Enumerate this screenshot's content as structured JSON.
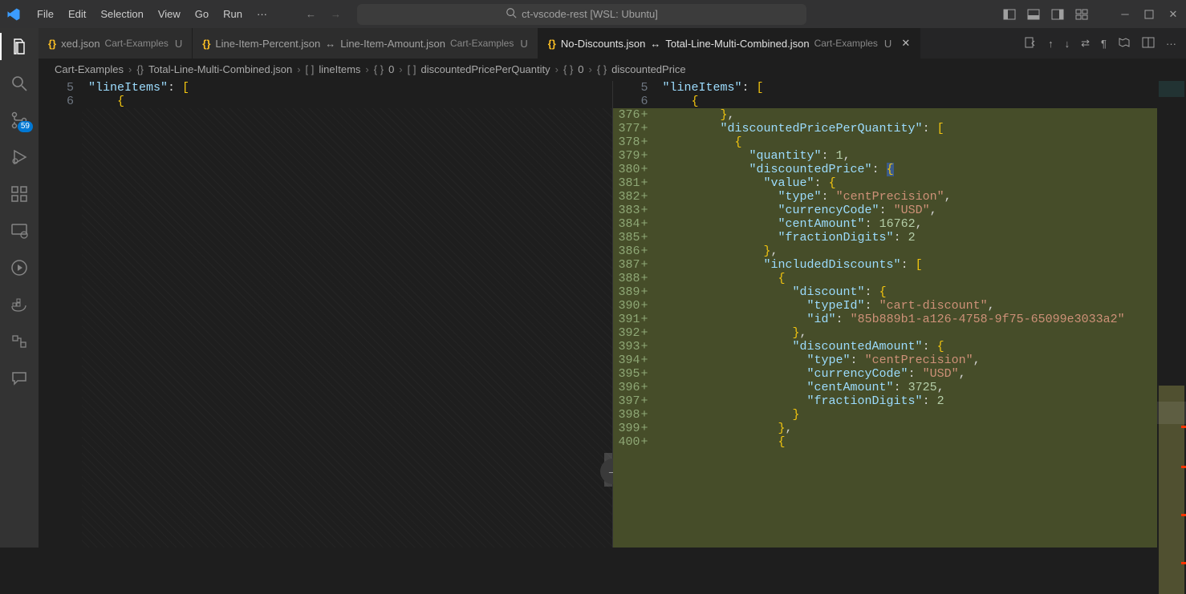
{
  "menu": [
    "File",
    "Edit",
    "Selection",
    "View",
    "Go",
    "Run",
    "···"
  ],
  "search_label": "ct-vscode-rest [WSL: Ubuntu]",
  "scm_badge": "59",
  "tabs": [
    {
      "icon": "{}",
      "title": "xed.json",
      "folder": "Cart-Examples",
      "mod": "U",
      "diff": false,
      "active": false
    },
    {
      "icon": "{}",
      "title": "Line-Item-Percent.json",
      "right": "Line-Item-Amount.json",
      "folder": "Cart-Examples",
      "mod": "U",
      "diff": true,
      "active": false
    },
    {
      "icon": "{}",
      "title": "No-Discounts.json",
      "right": "Total-Line-Multi-Combined.json",
      "folder": "Cart-Examples",
      "mod": "U",
      "diff": true,
      "active": true
    }
  ],
  "breadcrumb": [
    {
      "t": "Cart-Examples",
      "i": ""
    },
    {
      "t": "Total-Line-Multi-Combined.json",
      "i": "{}"
    },
    {
      "t": "lineItems",
      "i": "[ ]"
    },
    {
      "t": "0",
      "i": "{ }"
    },
    {
      "t": "discountedPricePerQuantity",
      "i": "[ ]"
    },
    {
      "t": "0",
      "i": "{ }"
    },
    {
      "t": "discountedPrice",
      "i": "{ }"
    }
  ],
  "left_header": [
    {
      "n": "5",
      "txt": [
        [
          "k",
          "\"lineItems\""
        ],
        [
          "p",
          ": "
        ],
        [
          "b",
          "["
        ]
      ]
    },
    {
      "n": "6",
      "txt": [
        [
          "b",
          "    {"
        ]
      ]
    }
  ],
  "right_header": [
    {
      "n": "5",
      "txt": [
        [
          "k",
          "\"lineItems\""
        ],
        [
          "p",
          ": "
        ],
        [
          "b",
          "["
        ]
      ]
    },
    {
      "n": "6",
      "txt": [
        [
          "b",
          "    {"
        ]
      ]
    }
  ],
  "right_lines": [
    {
      "n": "376",
      "txt": [
        [
          "p",
          "        "
        ],
        [
          "b",
          "}"
        ],
        [
          "p",
          ","
        ]
      ]
    },
    {
      "n": "377",
      "txt": [
        [
          "p",
          "        "
        ],
        [
          "k",
          "\"discountedPricePerQuantity\""
        ],
        [
          "p",
          ": "
        ],
        [
          "b",
          "["
        ]
      ]
    },
    {
      "n": "378",
      "txt": [
        [
          "p",
          "          "
        ],
        [
          "b",
          "{"
        ]
      ]
    },
    {
      "n": "379",
      "txt": [
        [
          "p",
          "            "
        ],
        [
          "k",
          "\"quantity\""
        ],
        [
          "p",
          ": "
        ],
        [
          "n",
          "1"
        ],
        [
          "p",
          ","
        ]
      ]
    },
    {
      "n": "380",
      "txt": [
        [
          "p",
          "            "
        ],
        [
          "k",
          "\"discountedPrice\""
        ],
        [
          "p",
          ": "
        ],
        [
          "hb",
          "{"
        ]
      ]
    },
    {
      "n": "381",
      "txt": [
        [
          "p",
          "              "
        ],
        [
          "k",
          "\"value\""
        ],
        [
          "p",
          ": "
        ],
        [
          "b",
          "{"
        ]
      ]
    },
    {
      "n": "382",
      "txt": [
        [
          "p",
          "                "
        ],
        [
          "k",
          "\"type\""
        ],
        [
          "p",
          ": "
        ],
        [
          "s",
          "\"centPrecision\""
        ],
        [
          "p",
          ","
        ]
      ]
    },
    {
      "n": "383",
      "txt": [
        [
          "p",
          "                "
        ],
        [
          "k",
          "\"currencyCode\""
        ],
        [
          "p",
          ": "
        ],
        [
          "s",
          "\"USD\""
        ],
        [
          "p",
          ","
        ]
      ]
    },
    {
      "n": "384",
      "txt": [
        [
          "p",
          "                "
        ],
        [
          "k",
          "\"centAmount\""
        ],
        [
          "p",
          ": "
        ],
        [
          "n",
          "16762"
        ],
        [
          "p",
          ","
        ]
      ]
    },
    {
      "n": "385",
      "txt": [
        [
          "p",
          "                "
        ],
        [
          "k",
          "\"fractionDigits\""
        ],
        [
          "p",
          ": "
        ],
        [
          "n",
          "2"
        ]
      ]
    },
    {
      "n": "386",
      "txt": [
        [
          "p",
          "              "
        ],
        [
          "b",
          "}"
        ],
        [
          "p",
          ","
        ]
      ]
    },
    {
      "n": "387",
      "txt": [
        [
          "p",
          "              "
        ],
        [
          "k",
          "\"includedDiscounts\""
        ],
        [
          "p",
          ": "
        ],
        [
          "b",
          "["
        ]
      ]
    },
    {
      "n": "388",
      "txt": [
        [
          "p",
          "                "
        ],
        [
          "b",
          "{"
        ]
      ]
    },
    {
      "n": "389",
      "txt": [
        [
          "p",
          "                  "
        ],
        [
          "k",
          "\"discount\""
        ],
        [
          "p",
          ": "
        ],
        [
          "b",
          "{"
        ]
      ]
    },
    {
      "n": "390",
      "txt": [
        [
          "p",
          "                    "
        ],
        [
          "k",
          "\"typeId\""
        ],
        [
          "p",
          ": "
        ],
        [
          "s",
          "\"cart-discount\""
        ],
        [
          "p",
          ","
        ]
      ]
    },
    {
      "n": "391",
      "txt": [
        [
          "p",
          "                    "
        ],
        [
          "k",
          "\"id\""
        ],
        [
          "p",
          ": "
        ],
        [
          "s",
          "\"85b889b1-a126-4758-9f75-65099e3033a2\""
        ]
      ]
    },
    {
      "n": "392",
      "txt": [
        [
          "p",
          "                  "
        ],
        [
          "b",
          "}"
        ],
        [
          "p",
          ","
        ]
      ]
    },
    {
      "n": "393",
      "txt": [
        [
          "p",
          "                  "
        ],
        [
          "k",
          "\"discountedAmount\""
        ],
        [
          "p",
          ": "
        ],
        [
          "b",
          "{"
        ]
      ]
    },
    {
      "n": "394",
      "txt": [
        [
          "p",
          "                    "
        ],
        [
          "k",
          "\"type\""
        ],
        [
          "p",
          ": "
        ],
        [
          "s",
          "\"centPrecision\""
        ],
        [
          "p",
          ","
        ]
      ]
    },
    {
      "n": "395",
      "txt": [
        [
          "p",
          "                    "
        ],
        [
          "k",
          "\"currencyCode\""
        ],
        [
          "p",
          ": "
        ],
        [
          "s",
          "\"USD\""
        ],
        [
          "p",
          ","
        ]
      ]
    },
    {
      "n": "396",
      "txt": [
        [
          "p",
          "                    "
        ],
        [
          "k",
          "\"centAmount\""
        ],
        [
          "p",
          ": "
        ],
        [
          "n",
          "3725"
        ],
        [
          "p",
          ","
        ]
      ]
    },
    {
      "n": "397",
      "txt": [
        [
          "p",
          "                    "
        ],
        [
          "k",
          "\"fractionDigits\""
        ],
        [
          "p",
          ": "
        ],
        [
          "n",
          "2"
        ]
      ]
    },
    {
      "n": "398",
      "txt": [
        [
          "p",
          "                  "
        ],
        [
          "b",
          "}"
        ]
      ]
    },
    {
      "n": "399",
      "txt": [
        [
          "p",
          "                "
        ],
        [
          "b",
          "}"
        ],
        [
          "p",
          ","
        ]
      ]
    },
    {
      "n": "400",
      "txt": [
        [
          "p",
          "                "
        ],
        [
          "b",
          "{"
        ]
      ]
    }
  ]
}
